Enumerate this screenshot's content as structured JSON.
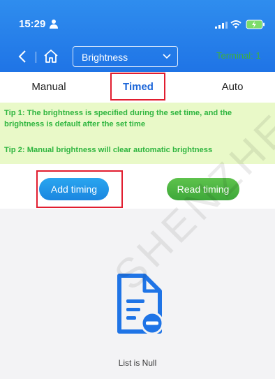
{
  "status_bar": {
    "time": "15:29"
  },
  "nav": {
    "screen_selector": "Brightness",
    "terminal_label": "Terminal: 1"
  },
  "tabs": [
    {
      "label": "Manual"
    },
    {
      "label": "Timed",
      "selected": true
    },
    {
      "label": "Auto"
    }
  ],
  "tips": {
    "tip1": "Tip 1: The brightness is specified during the set time, and the brightness is default after the set time",
    "tip2": "Tip 2: Manual brightness will clear automatic brightness"
  },
  "buttons": {
    "add_timing": "Add timing",
    "read_timing": "Read timing"
  },
  "list": {
    "empty_text": "List is Null"
  },
  "watermark": "SHENZHEN SYSOLUTION",
  "colors": {
    "header_blue": "#1f74e6",
    "selected_tab": "#1e67d9",
    "tip_text": "#2fb53f",
    "tip_background": "#e9f9c8",
    "add_button": "#1a86e0",
    "read_button": "#3ea83a",
    "highlight_frame": "#e11d2f"
  },
  "icons": [
    "person-icon",
    "signal-icon",
    "wifi-icon",
    "battery-icon",
    "back-icon",
    "home-icon",
    "chevron-down-icon",
    "empty-document-icon"
  ]
}
